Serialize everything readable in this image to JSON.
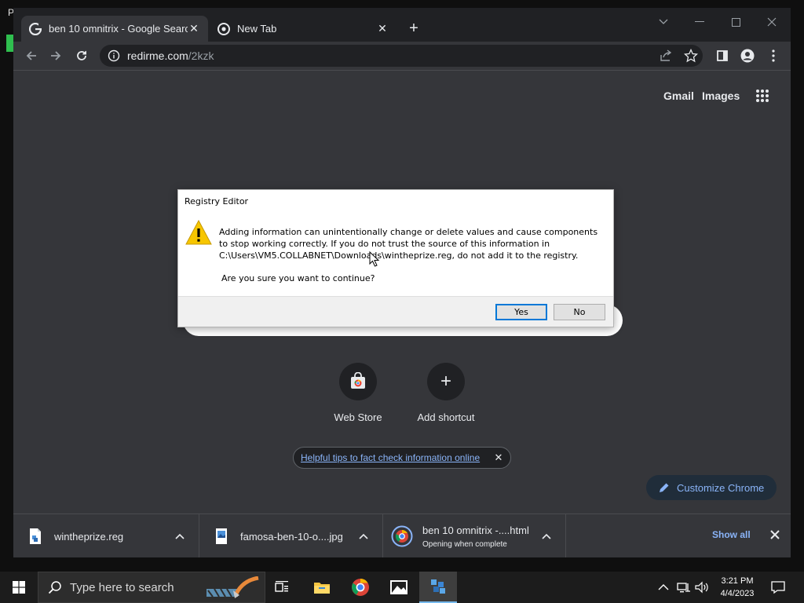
{
  "desktop": {
    "edge_text": "P"
  },
  "browser": {
    "tabs": [
      {
        "title": "ben 10 omnitrix - Google Search",
        "active": true
      },
      {
        "title": "New Tab",
        "active": false
      }
    ],
    "address": {
      "host": "redirme.com",
      "path": "/2kzk"
    }
  },
  "ntp": {
    "top_links": {
      "gmail": "Gmail",
      "images": "Images"
    },
    "shortcuts": [
      {
        "label": "Web Store"
      },
      {
        "label": "Add shortcut"
      }
    ],
    "tip": "Helpful tips to fact check information online",
    "customize": "Customize Chrome"
  },
  "dialog": {
    "title": "Registry Editor",
    "message": "Adding information can unintentionally change or delete values and cause components to stop working correctly. If you do not trust the source of this information in C:\\Users\\VM5.COLLABNET\\Downloads\\wintheprize.reg, do not add it to the registry.",
    "question": "Are you sure you want to continue?",
    "yes": "Yes",
    "no": "No"
  },
  "downloads": {
    "items": [
      {
        "name": "wintheprize.reg",
        "status": ""
      },
      {
        "name": "famosa-ben-10-o....jpg",
        "status": ""
      },
      {
        "name": "ben 10 omnitrix -....html",
        "status": "Opening when complete"
      }
    ],
    "show_all": "Show all"
  },
  "taskbar": {
    "search_placeholder": "Type here to search",
    "time": "3:21 PM",
    "date": "4/4/2023"
  },
  "colors": {
    "chrome_dark": "#202124",
    "chrome_toolbar": "#35363a",
    "link_blue": "#8ab4f8",
    "dialog_default_button": "#0078d7",
    "warning_yellow": "#f7c600"
  }
}
